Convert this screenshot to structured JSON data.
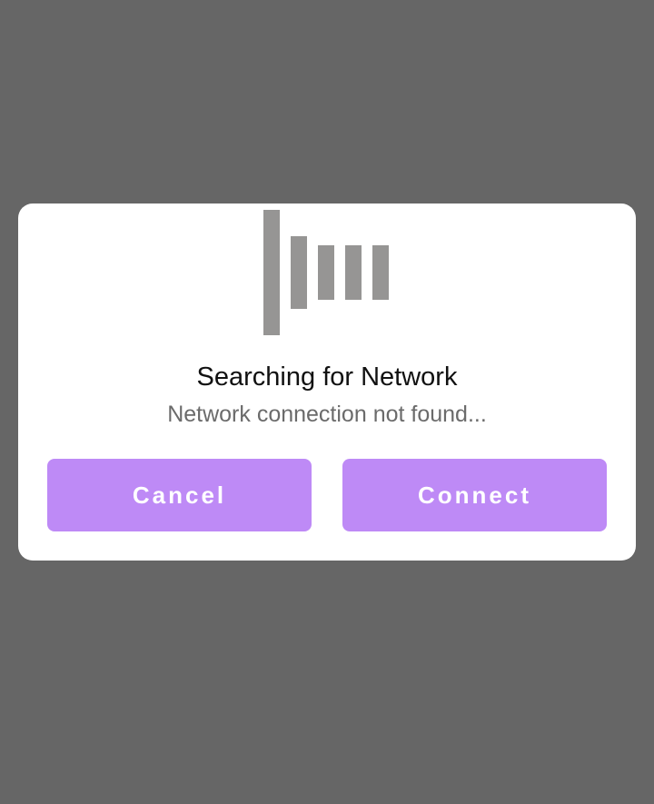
{
  "dialog": {
    "title": "Searching for Network",
    "message": "Network connection not found...",
    "cancel_label": "Cancel",
    "connect_label": "Connect",
    "loader_icon": "signal-bars-loading-icon"
  },
  "colors": {
    "backdrop": "#666666",
    "dialog_background": "#ffffff",
    "button": "#be8af6",
    "loader_bars": "#969594"
  }
}
